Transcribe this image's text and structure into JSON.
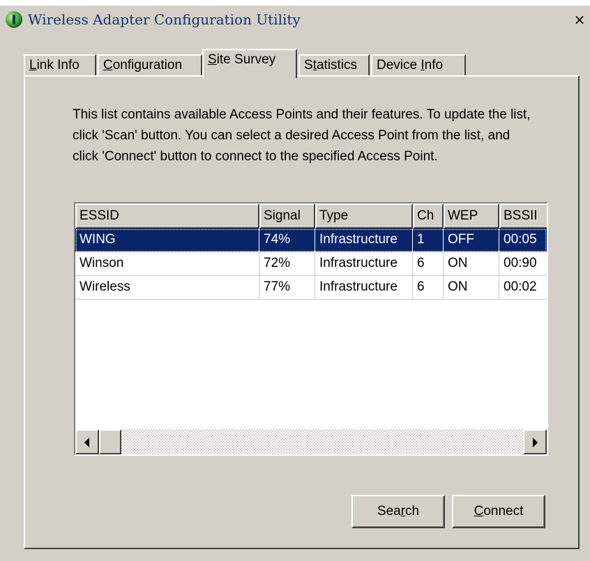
{
  "window": {
    "title": "Wireless Adapter Configuration Utility",
    "close_glyph": "×"
  },
  "tabs": [
    {
      "prefix": "",
      "accel": "L",
      "suffix": "ink Info"
    },
    {
      "prefix": "",
      "accel": "C",
      "suffix": "onfiguration"
    },
    {
      "prefix": "",
      "accel": "S",
      "suffix": "ite Survey"
    },
    {
      "prefix": "S",
      "accel": "t",
      "suffix": "atistics"
    },
    {
      "prefix": "Device ",
      "accel": "I",
      "suffix": "nfo"
    }
  ],
  "active_tab": "Site Survey",
  "description": "This list contains available Access Points and their features. To update the list, click 'Scan' button. You can select a desired Access Point from the list, and click 'Connect' button to connect to the specified Access Point.",
  "table": {
    "columns": [
      "ESSID",
      "Signal",
      "Type",
      "Ch",
      "WEP",
      "BSSII"
    ],
    "rows": [
      [
        "WING",
        "74%",
        "Infrastructure",
        "1",
        "OFF",
        "00:05"
      ],
      [
        "Winson",
        "72%",
        "Infrastructure",
        "6",
        "ON",
        "00:90"
      ],
      [
        "Wireless",
        "77%",
        "Infrastructure",
        "6",
        "ON",
        "00:02"
      ]
    ],
    "selected_row": 0
  },
  "buttons": {
    "search": {
      "prefix": "Sea",
      "accel": "r",
      "suffix": "ch"
    },
    "connect": {
      "prefix": "",
      "accel": "C",
      "suffix": "onnect"
    }
  },
  "colors": {
    "selection": "#0a246a",
    "face": "#d4d0c8",
    "title_text": "#14326e"
  }
}
